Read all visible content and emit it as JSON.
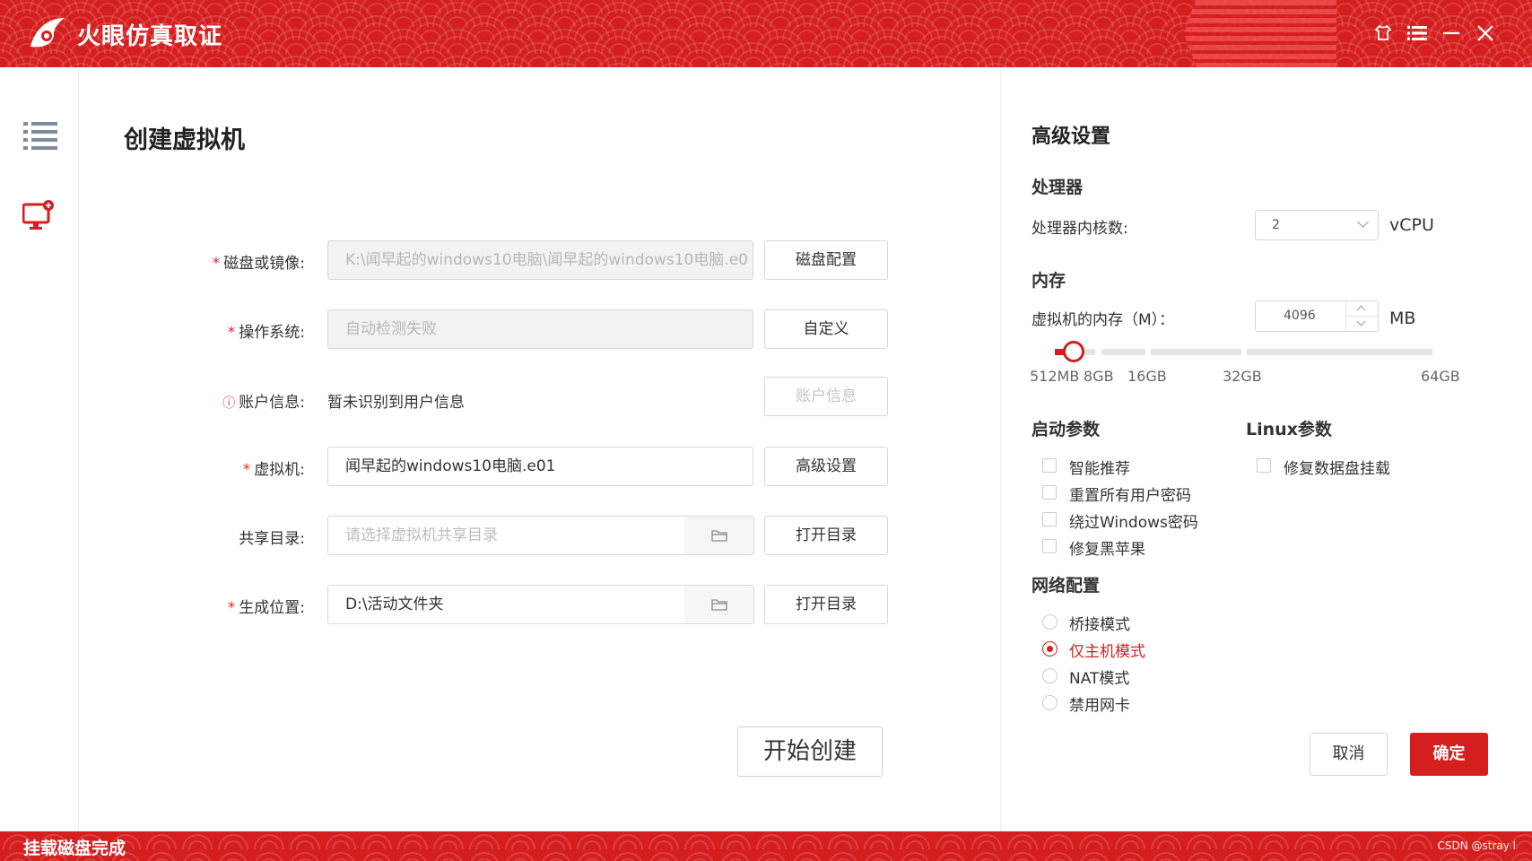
{
  "app": {
    "title": "火眼仿真取证"
  },
  "main": {
    "page_title": "创建虚拟机",
    "fields": {
      "disk": {
        "label": "磁盘或镜像:",
        "value": "K:\\闻早起的windows10电脑\\闻早起的windows10电脑.e0",
        "button": "磁盘配置"
      },
      "os": {
        "label": "操作系统:",
        "value": "自动检测失败",
        "button": "自定义"
      },
      "account": {
        "label": "账户信息:",
        "value": "暂未识别到用户信息",
        "button": "账户信息"
      },
      "vm": {
        "label": "虚拟机:",
        "value": "闻早起的windows10电脑.e01",
        "button": "高级设置"
      },
      "share": {
        "label": "共享目录:",
        "placeholder": "请选择虚拟机共享目录",
        "button": "打开目录"
      },
      "output": {
        "label": "生成位置:",
        "value": "D:\\活动文件夹",
        "button": "打开目录"
      }
    },
    "start_button": "开始创建"
  },
  "advanced": {
    "title": "高级设置",
    "processor": {
      "section": "处理器",
      "label": "处理器内核数:",
      "value": "2",
      "unit": "vCPU"
    },
    "memory": {
      "section": "内存",
      "label": "虚拟机的内存（M）：",
      "value": "4096",
      "unit": "MB",
      "ticks": [
        "512MB",
        "8GB",
        "16GB",
        "32GB",
        "64GB"
      ],
      "current_mb": 4096,
      "min_mb": 512,
      "max_mb": 65536
    },
    "boot": {
      "section": "启动参数",
      "options": [
        {
          "label": "智能推荐",
          "checked": false
        },
        {
          "label": "重置所有用户密码",
          "checked": false
        },
        {
          "label": "绕过Windows密码",
          "checked": false
        },
        {
          "label": "修复黑苹果",
          "checked": false
        }
      ]
    },
    "linux": {
      "section": "Linux参数",
      "options": [
        {
          "label": "修复数据盘挂载",
          "checked": false
        }
      ]
    },
    "network": {
      "section": "网络配置",
      "options": [
        {
          "label": "桥接模式",
          "selected": false
        },
        {
          "label": "仅主机模式",
          "selected": true
        },
        {
          "label": "NAT模式",
          "selected": false
        },
        {
          "label": "禁用网卡",
          "selected": false
        }
      ]
    },
    "cancel": "取消",
    "ok": "确定"
  },
  "status": {
    "text": "挂载磁盘完成",
    "watermark": "CSDN @stray l"
  },
  "colors": {
    "accent": "#d51f1f"
  }
}
